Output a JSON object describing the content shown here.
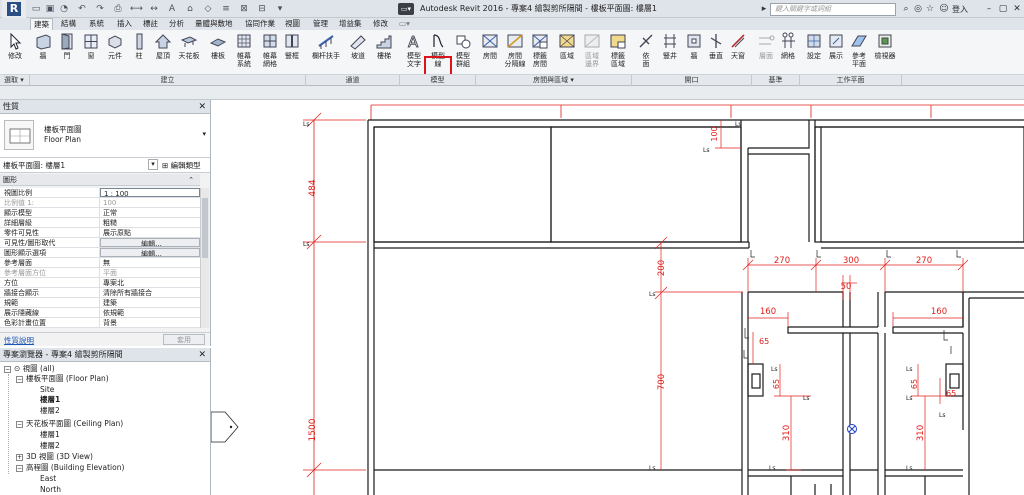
{
  "window": {
    "title": "Autodesk Revit 2016 -   專案4 繪製剪所隔間 - 樓板平面圖: 樓層1",
    "search_placeholder": "鍵入關鍵字或詞組",
    "user_label": "登入"
  },
  "ribbon": {
    "tabs": [
      "建築",
      "結構",
      "系統",
      "插入",
      "標註",
      "分析",
      "量體與敷地",
      "協同作業",
      "視圖",
      "管理",
      "增益集",
      "修改"
    ],
    "active_tab": "建築",
    "buttons": {
      "modify": "修改",
      "wall": "牆",
      "door": "門",
      "window": "窗",
      "component": "元件",
      "column": "柱",
      "roof": "屋頂",
      "ceiling": "天花板",
      "floor": "樓板",
      "curtain_system": "帷幕\n系統",
      "curtain_grid": "帷幕\n網格",
      "mullion": "豎框",
      "railing": "欄杆扶手",
      "ramp": "坡道",
      "stair": "樓梯",
      "model_text": "模型\n文字",
      "model_line": "模型\n線",
      "model_group": "模型\n群組",
      "room": "房間",
      "room_separator": "房間\n分隔線",
      "tag_room": "標籤\n房間",
      "area": "區域",
      "area_boundary": "區域\n邊界",
      "tag_area": "標籤\n區域",
      "by_face": "依\n面",
      "shaft": "豎井",
      "wall_opening": "牆",
      "vertical": "垂直",
      "dormer": "天窗",
      "level": "層面",
      "grid": "網格",
      "set": "設定",
      "show": "展示",
      "ref_plane": "參考\n平面",
      "viewer": "檢視器"
    },
    "groups": {
      "select": "選取 ▾",
      "build": "建立",
      "circulation": "通道",
      "model": "模型",
      "room_area": "房間與區域 ▾",
      "opening": "開口",
      "datum": "基準",
      "work_plane": "工作平面"
    }
  },
  "properties": {
    "panel_title": "性質",
    "type_name_zh": "樓板平面圖",
    "type_name_en": "Floor Plan",
    "instance_selector": "樓板平面圖: 樓層1",
    "edit_type": "編輯類型",
    "group_graphics": "圖形",
    "rows": [
      {
        "k": "視圖比例",
        "v": "1 : 100",
        "input": true
      },
      {
        "k": "比例值 1:",
        "v": "100",
        "dim": true
      },
      {
        "k": "顯示模型",
        "v": "正常"
      },
      {
        "k": "詳細層級",
        "v": "粗糙"
      },
      {
        "k": "零件可見性",
        "v": "展示原點"
      },
      {
        "k": "可見性/圖形取代",
        "v": "編輯...",
        "btn": true
      },
      {
        "k": "圖形顯示選項",
        "v": "編輯...",
        "btn": true
      },
      {
        "k": "參考層面",
        "v": "無"
      },
      {
        "k": "參考層面方位",
        "v": "平面",
        "dim": true
      },
      {
        "k": "方位",
        "v": "專案北"
      },
      {
        "k": "牆接合顯示",
        "v": "清除所有牆接合"
      },
      {
        "k": "規範",
        "v": "建築"
      },
      {
        "k": "展示隱藏線",
        "v": "依規範"
      },
      {
        "k": "色彩計畫位置",
        "v": "背景"
      }
    ],
    "help_link": "性質說明",
    "apply": "套用"
  },
  "browser": {
    "panel_title": "專案瀏覽器 - 專案4 繪製剪所隔間",
    "nodes": [
      {
        "label": "視圖 (all)",
        "level": 0,
        "exp": "−"
      },
      {
        "label": "樓板平面圖 (Floor Plan)",
        "level": 1,
        "exp": "−"
      },
      {
        "label": "Site",
        "level": 2
      },
      {
        "label": "樓層1",
        "level": 2,
        "selected": true
      },
      {
        "label": "樓層2",
        "level": 2
      },
      {
        "label": "天花板平面圖 (Ceiling Plan)",
        "level": 1,
        "exp": "−"
      },
      {
        "label": "樓層1",
        "level": 2
      },
      {
        "label": "樓層2",
        "level": 2
      },
      {
        "label": "3D 視圖 (3D View)",
        "level": 1,
        "exp": "+"
      },
      {
        "label": "高程圖 (Building Elevation)",
        "level": 1,
        "exp": "−"
      },
      {
        "label": "East",
        "level": 2
      },
      {
        "label": "North",
        "level": 2
      }
    ]
  },
  "drawing": {
    "dimensions": {
      "d484": "484",
      "d1500": "1500",
      "d100": "100",
      "d200": "200",
      "d700": "700",
      "d270a": "270",
      "d300": "300",
      "d270b": "270",
      "d50": "50",
      "d160a": "160",
      "d160b": "160",
      "d65a": "65",
      "d65b": "65",
      "d65c": "65",
      "d65d": "65",
      "d310a": "310",
      "d310b": "310"
    },
    "tag_text": "Ls",
    "colors": {
      "dimension": "#e0201c",
      "wall": "#1a1a1a",
      "highlight": "#d9141b",
      "symbol": "#1f3fbf"
    }
  }
}
